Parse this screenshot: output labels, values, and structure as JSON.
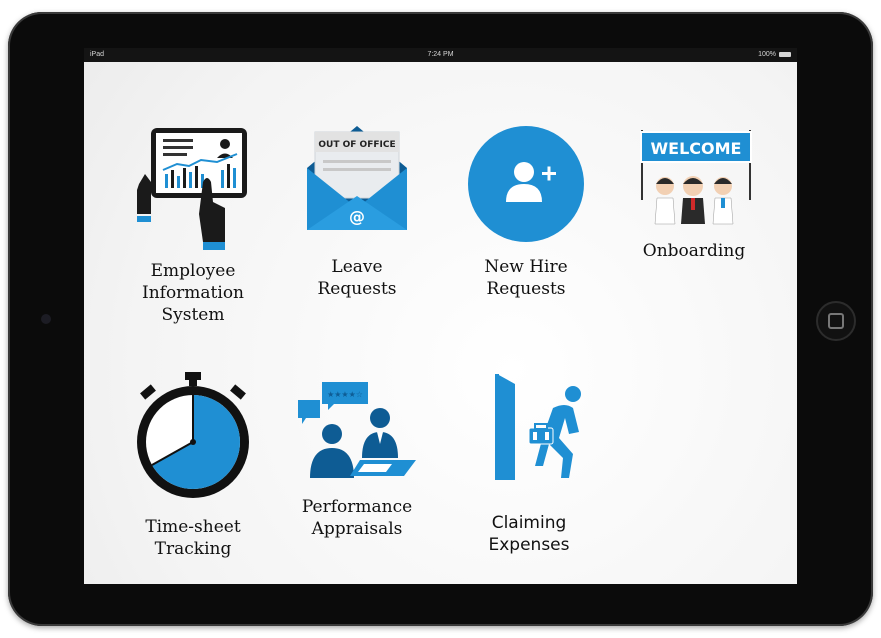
{
  "status_bar": {
    "device": "iPad",
    "time": "7:24 PM",
    "battery": "100%"
  },
  "tiles": [
    {
      "label": "Employee\nInformation\nSystem",
      "icon": "employee-info-icon"
    },
    {
      "label": "Leave\nRequests",
      "icon": "out-of-office-envelope-icon",
      "icon_text": "OUT OF OFFICE"
    },
    {
      "label": "New Hire\nRequests",
      "icon": "add-user-icon"
    },
    {
      "label": "Onboarding",
      "icon": "welcome-banner-icon",
      "icon_text": "WELCOME"
    },
    {
      "label": "Time-sheet\nTracking",
      "icon": "stopwatch-icon"
    },
    {
      "label": "Performance\nAppraisals",
      "icon": "performance-review-icon"
    },
    {
      "label": "Claiming\nExpenses",
      "icon": "traveler-exit-icon"
    }
  ],
  "colors": {
    "primary_blue": "#1f8fd3",
    "dark_blue": "#0e5c94",
    "bezel": "#0b0b0b"
  }
}
